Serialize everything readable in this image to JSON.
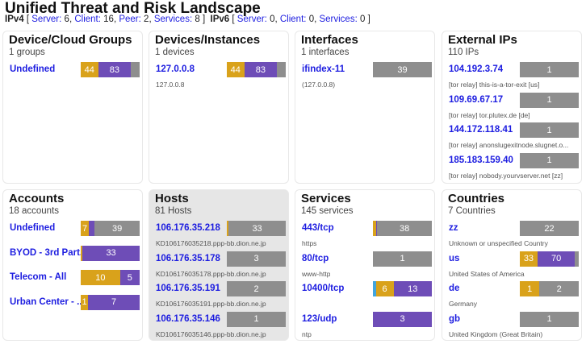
{
  "title": "Unified Threat and Risk Landscape",
  "stats": {
    "ipv4_label": "IPv4",
    "ipv4_items": [
      {
        "label": "Server:",
        "value": "6"
      },
      {
        "label": "Client:",
        "value": "16"
      },
      {
        "label": "Peer:",
        "value": "2"
      },
      {
        "label": "Services:",
        "value": "8"
      }
    ],
    "ipv6_label": "IPv6",
    "ipv6_items": [
      {
        "label": "Server:",
        "value": "0"
      },
      {
        "label": "Client:",
        "value": "0"
      },
      {
        "label": "Services:",
        "value": "0"
      }
    ]
  },
  "colors": {
    "yellow": "#d9a21b",
    "purple": "#6e4db7",
    "gray": "#8e8e8e",
    "blue": "#42a5de"
  },
  "panels": {
    "device_groups": {
      "title": "Device/Cloud Groups",
      "subtitle": "1 groups",
      "entries": [
        {
          "name": "Undefined",
          "desc": "",
          "segments": [
            {
              "color": "yellow",
              "value": 44,
              "label": "44"
            },
            {
              "color": "purple",
              "value": 83,
              "label": "83"
            },
            {
              "color": "gray",
              "value": 22,
              "label": ""
            }
          ]
        }
      ]
    },
    "devices": {
      "title": "Devices/Instances",
      "subtitle": "1 devices",
      "entries": [
        {
          "name": "127.0.0.8",
          "desc": "127.0.0.8",
          "segments": [
            {
              "color": "yellow",
              "value": 44,
              "label": "44"
            },
            {
              "color": "purple",
              "value": 83,
              "label": "83"
            },
            {
              "color": "gray",
              "value": 22,
              "label": ""
            }
          ]
        }
      ]
    },
    "interfaces": {
      "title": "Interfaces",
      "subtitle": "1 interfaces",
      "entries": [
        {
          "name": "ifindex-11",
          "desc": "(127.0.0.8)",
          "segments": [
            {
              "color": "gray",
              "value": 39,
              "label": "39"
            }
          ]
        }
      ]
    },
    "external_ips": {
      "title": "External IPs",
      "subtitle": "110 IPs",
      "entries": [
        {
          "name": "104.192.3.74",
          "desc": "[tor relay] this-is-a-tor-exit [us]",
          "segments": [
            {
              "color": "gray",
              "value": 1,
              "label": "1"
            }
          ]
        },
        {
          "name": "109.69.67.17",
          "desc": "[tor relay] tor.plutex.de [de]",
          "segments": [
            {
              "color": "gray",
              "value": 1,
              "label": "1"
            }
          ]
        },
        {
          "name": "144.172.118.41",
          "desc": "[tor relay] anonslugexitnode.slugnet.o...",
          "segments": [
            {
              "color": "gray",
              "value": 1,
              "label": "1"
            }
          ]
        },
        {
          "name": "185.183.159.40",
          "desc": "[tor relay] nobody.yourvserver.net [zz]",
          "segments": [
            {
              "color": "gray",
              "value": 1,
              "label": "1"
            }
          ]
        }
      ]
    },
    "accounts": {
      "title": "Accounts",
      "subtitle": "18 accounts",
      "entries": [
        {
          "name": "Undefined",
          "desc": "",
          "segments": [
            {
              "color": "yellow",
              "value": 7,
              "label": "7"
            },
            {
              "color": "purple",
              "value": 5,
              "label": ""
            },
            {
              "color": "gray",
              "value": 39,
              "label": "39"
            }
          ]
        },
        {
          "name": "BYOD - 3rd Part...",
          "desc": "",
          "segments": [
            {
              "color": "yellow",
              "value": 1,
              "label": ""
            },
            {
              "color": "purple",
              "value": 33,
              "label": "33"
            }
          ]
        },
        {
          "name": "Telecom - All",
          "desc": "",
          "segments": [
            {
              "color": "yellow",
              "value": 10,
              "label": "10"
            },
            {
              "color": "purple",
              "value": 5,
              "label": "5"
            }
          ]
        },
        {
          "name": "Urban Center - ...",
          "desc": "",
          "segments": [
            {
              "color": "yellow",
              "value": 1,
              "label": "1"
            },
            {
              "color": "purple",
              "value": 7,
              "label": "7"
            }
          ]
        }
      ]
    },
    "hosts": {
      "title": "Hosts",
      "subtitle": "81 Hosts",
      "entries": [
        {
          "name": "106.176.35.218",
          "desc": "KD106176035218.ppp-bb.dion.ne.jp",
          "segments": [
            {
              "color": "yellow",
              "value": 1,
              "label": ""
            },
            {
              "color": "gray",
              "value": 33,
              "label": "33"
            }
          ]
        },
        {
          "name": "106.176.35.178",
          "desc": "KD106176035178.ppp-bb.dion.ne.jp",
          "segments": [
            {
              "color": "gray",
              "value": 3,
              "label": "3"
            }
          ]
        },
        {
          "name": "106.176.35.191",
          "desc": "KD106176035191.ppp-bb.dion.ne.jp",
          "segments": [
            {
              "color": "gray",
              "value": 2,
              "label": "2"
            }
          ]
        },
        {
          "name": "106.176.35.146",
          "desc": "KD106176035146.ppp-bb.dion.ne.jp",
          "segments": [
            {
              "color": "gray",
              "value": 1,
              "label": "1"
            }
          ]
        }
      ]
    },
    "services": {
      "title": "Services",
      "subtitle": "145 services",
      "entries": [
        {
          "name": "443/tcp",
          "desc": "https",
          "segments": [
            {
              "color": "yellow",
              "value": 2,
              "label": ""
            },
            {
              "color": "purple",
              "value": 1,
              "label": ""
            },
            {
              "color": "gray",
              "value": 38,
              "label": "38"
            }
          ]
        },
        {
          "name": "80/tcp",
          "desc": "www-http",
          "segments": [
            {
              "color": "gray",
              "value": 1,
              "label": "1"
            }
          ]
        },
        {
          "name": "10400/tcp",
          "desc": "",
          "segments": [
            {
              "color": "blue",
              "value": 1,
              "label": ""
            },
            {
              "color": "yellow",
              "value": 6,
              "label": "6"
            },
            {
              "color": "purple",
              "value": 13,
              "label": "13"
            }
          ]
        },
        {
          "name": "123/udp",
          "desc": "ntp",
          "segments": [
            {
              "color": "purple",
              "value": 3,
              "label": "3"
            }
          ]
        }
      ]
    },
    "countries": {
      "title": "Countries",
      "subtitle": "7 Countries",
      "entries": [
        {
          "name": "zz",
          "desc": "Unknown or unspecified Country",
          "segments": [
            {
              "color": "gray",
              "value": 22,
              "label": "22"
            }
          ]
        },
        {
          "name": "us",
          "desc": "United States of America",
          "segments": [
            {
              "color": "yellow",
              "value": 33,
              "label": "33"
            },
            {
              "color": "purple",
              "value": 70,
              "label": "70"
            },
            {
              "color": "gray",
              "value": 7,
              "label": ""
            }
          ]
        },
        {
          "name": "de",
          "desc": "Germany",
          "segments": [
            {
              "color": "yellow",
              "value": 1,
              "label": "1"
            },
            {
              "color": "gray",
              "value": 2,
              "label": "2"
            }
          ]
        },
        {
          "name": "gb",
          "desc": "United Kingdom (Great Britain)",
          "segments": [
            {
              "color": "gray",
              "value": 1,
              "label": "1"
            }
          ]
        }
      ]
    }
  }
}
